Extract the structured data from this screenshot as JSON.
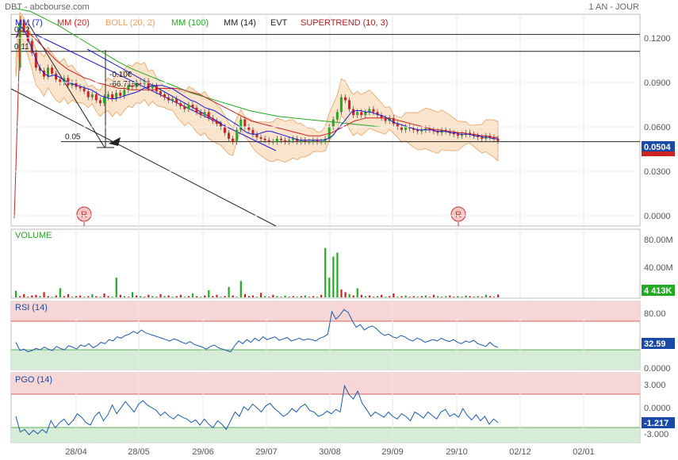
{
  "header": {
    "title": "DBT - abcbourse.com",
    "period": "1 AN - JOUR"
  },
  "legend": [
    {
      "label": "MM (7)",
      "color": "#1a1ad6"
    },
    {
      "label": "MM (20)",
      "color": "#cc2222"
    },
    {
      "label": "BOLL (20, 2)",
      "color": "#e8a060"
    },
    {
      "label": "MM (100)",
      "color": "#22aa22"
    },
    {
      "label": "MM (14)",
      "color": "#222222"
    },
    {
      "label": "EVT",
      "color": "#222222"
    },
    {
      "label": "SUPERTREND (10, 3)",
      "color": "#aa2222"
    }
  ],
  "price_panel": {
    "y_ticks": [
      "0.1200",
      "0.0900",
      "0.0600",
      "0.0300",
      "0.0000"
    ],
    "last_price": "0.0504",
    "h_line_labels": [
      "0.12",
      "0.11",
      "0.05"
    ],
    "annotation": [
      "-0.10€",
      "-66.71%"
    ],
    "markers": [
      "R",
      "R"
    ]
  },
  "volume_panel": {
    "title": "VOLUME",
    "y_ticks": [
      "80.00M",
      "40.00M"
    ],
    "last_value": "4 413K"
  },
  "rsi_panel": {
    "title": "RSI (14)",
    "y_ticks": [
      "80.00",
      "0.0000"
    ],
    "last_value": "32.59"
  },
  "pgo_panel": {
    "title": "PGO (14)",
    "y_ticks": [
      "3.000",
      "0.0000",
      "-3.000"
    ],
    "last_value": "-1.217"
  },
  "x_axis": {
    "labels": [
      "28/04",
      "28/05",
      "29/06",
      "29/07",
      "30/08",
      "29/09",
      "29/10",
      "02/12",
      "02/01"
    ]
  },
  "chart_data": {
    "type": "line",
    "x_range": [
      "2023-04-14",
      "2024-01-15"
    ],
    "price": {
      "ylim": [
        0.0,
        0.135
      ],
      "close": [
        0.1,
        0.13,
        0.125,
        0.118,
        0.11,
        0.1,
        0.098,
        0.094,
        0.1,
        0.096,
        0.092,
        0.09,
        0.093,
        0.088,
        0.09,
        0.087,
        0.086,
        0.084,
        0.08,
        0.082,
        0.078,
        0.076,
        0.08,
        0.082,
        0.079,
        0.083,
        0.081,
        0.085,
        0.088,
        0.087,
        0.09,
        0.089,
        0.091,
        0.086,
        0.088,
        0.084,
        0.082,
        0.08,
        0.078,
        0.079,
        0.076,
        0.074,
        0.072,
        0.075,
        0.073,
        0.07,
        0.068,
        0.07,
        0.066,
        0.064,
        0.062,
        0.06,
        0.056,
        0.052,
        0.05,
        0.058,
        0.065,
        0.06,
        0.058,
        0.055,
        0.053,
        0.052,
        0.051,
        0.05,
        0.05,
        0.052,
        0.051,
        0.05,
        0.051,
        0.052,
        0.05,
        0.051,
        0.05,
        0.05,
        0.051,
        0.05,
        0.05,
        0.052,
        0.06,
        0.065,
        0.07,
        0.08,
        0.078,
        0.072,
        0.068,
        0.07,
        0.068,
        0.07,
        0.072,
        0.07,
        0.068,
        0.066,
        0.064,
        0.066,
        0.062,
        0.06,
        0.058,
        0.06,
        0.059,
        0.058,
        0.057,
        0.058,
        0.059,
        0.058,
        0.057,
        0.056,
        0.058,
        0.057,
        0.056,
        0.055,
        0.054,
        0.055,
        0.056,
        0.055,
        0.054,
        0.053,
        0.052,
        0.054,
        0.053,
        0.052,
        0.0504
      ],
      "mm7": [
        0.12,
        0.128,
        0.124,
        0.116,
        0.108,
        0.1,
        0.096,
        0.094,
        0.095,
        0.094,
        0.092,
        0.09,
        0.089,
        0.088,
        0.087,
        0.086,
        0.085,
        0.083,
        0.081,
        0.08,
        0.079,
        0.079,
        0.08,
        0.081,
        0.082,
        0.083,
        0.084,
        0.086,
        0.087,
        0.088,
        0.088,
        0.088,
        0.087,
        0.086,
        0.084,
        0.082,
        0.08,
        0.078,
        0.077,
        0.075,
        0.073,
        0.072,
        0.071,
        0.069,
        0.067,
        0.065,
        0.063,
        0.061,
        0.058,
        0.056,
        0.055,
        0.055,
        0.056,
        0.057,
        0.057,
        0.056,
        0.055,
        0.054,
        0.053,
        0.052,
        0.051,
        0.051,
        0.051,
        0.051,
        0.051,
        0.051,
        0.052,
        0.054,
        0.058,
        0.062,
        0.066,
        0.07,
        0.071,
        0.071,
        0.07,
        0.07,
        0.069,
        0.068,
        0.067,
        0.065,
        0.063,
        0.062,
        0.061,
        0.06,
        0.059,
        0.058,
        0.058,
        0.058,
        0.058,
        0.057,
        0.057,
        0.057,
        0.056,
        0.056,
        0.055,
        0.055,
        0.055,
        0.054,
        0.054,
        0.053,
        0.053,
        0.052,
        0.052
      ],
      "mm20": [
        0.12,
        0.125,
        0.124,
        0.121,
        0.117,
        0.113,
        0.109,
        0.105,
        0.102,
        0.099,
        0.097,
        0.095,
        0.093,
        0.092,
        0.09,
        0.089,
        0.088,
        0.087,
        0.086,
        0.086,
        0.085,
        0.085,
        0.085,
        0.085,
        0.085,
        0.086,
        0.086,
        0.086,
        0.086,
        0.085,
        0.084,
        0.083,
        0.082,
        0.08,
        0.078,
        0.076,
        0.074,
        0.072,
        0.07,
        0.068,
        0.066,
        0.064,
        0.063,
        0.062,
        0.061,
        0.06,
        0.059,
        0.058,
        0.057,
        0.056,
        0.055,
        0.054,
        0.054,
        0.054,
        0.055,
        0.056,
        0.058,
        0.06,
        0.062,
        0.064,
        0.065,
        0.066,
        0.066,
        0.066,
        0.066,
        0.066,
        0.065,
        0.064,
        0.063,
        0.062,
        0.061,
        0.06,
        0.059,
        0.058,
        0.058,
        0.057,
        0.057,
        0.056,
        0.056,
        0.055,
        0.055,
        0.054,
        0.054,
        0.053,
        0.053
      ],
      "mm100": [
        0.14,
        0.138,
        0.133,
        0.128,
        0.122,
        0.116,
        0.11,
        0.104,
        0.099,
        0.095,
        0.091,
        0.087,
        0.083,
        0.08,
        0.077,
        0.074,
        0.071,
        0.069,
        0.067,
        0.066,
        0.065,
        0.064,
        0.063,
        0.062,
        0.061,
        0.06,
        0.06,
        0.06,
        0.06,
        0.06,
        0.06,
        0.06,
        0.06,
        0.06
      ],
      "h_lines": [
        0.1225,
        0.111,
        0.05
      ]
    },
    "volume": {
      "ylim": [
        0,
        100
      ],
      "unit": "M",
      "values": [
        10,
        2,
        5,
        1,
        3,
        4,
        2,
        8,
        2,
        1,
        3,
        14,
        2,
        5,
        1,
        2,
        3,
        1,
        2,
        5,
        2,
        1,
        6,
        2,
        1,
        30,
        4,
        2,
        1,
        8,
        3,
        2,
        1,
        4,
        2,
        1,
        5,
        2,
        3,
        1,
        2,
        4,
        1,
        2,
        6,
        2,
        1,
        3,
        11,
        2,
        4,
        1,
        2,
        16,
        3,
        1,
        25,
        5,
        2,
        3,
        1,
        7,
        2,
        1,
        4,
        2,
        1,
        3,
        1,
        2,
        1,
        2,
        3,
        1,
        2,
        1,
        4,
        75,
        30,
        62,
        68,
        12,
        8,
        5,
        3,
        14,
        4,
        2,
        3,
        1,
        2,
        4,
        1,
        2,
        6,
        1,
        2,
        3,
        1,
        2,
        1,
        2,
        3,
        1,
        4,
        2,
        1,
        2,
        3,
        1,
        2,
        1,
        3,
        2,
        1,
        2,
        1,
        4,
        2,
        1,
        4.4
      ],
      "up": [
        true,
        false,
        false,
        false,
        false,
        false,
        true,
        false,
        false,
        true,
        false,
        true,
        false,
        false,
        true,
        false,
        false,
        true,
        false,
        true,
        false,
        true,
        false,
        false,
        true,
        true,
        false,
        true,
        false,
        true,
        false,
        true,
        false,
        false,
        true,
        false,
        false,
        true,
        false,
        true,
        false,
        false,
        true,
        false,
        true,
        false,
        true,
        false,
        true,
        false,
        false,
        true,
        false,
        true,
        false,
        true,
        true,
        false,
        false,
        false,
        true,
        false,
        true,
        false,
        false,
        true,
        false,
        true,
        false,
        false,
        true,
        false,
        true,
        false,
        false,
        true,
        false,
        true,
        true,
        true,
        true,
        false,
        false,
        true,
        false,
        true,
        false,
        true,
        false,
        false,
        true,
        false,
        true,
        false,
        false,
        true,
        false,
        true,
        false,
        false,
        true,
        false,
        true,
        false,
        false,
        true,
        false,
        true,
        false,
        false,
        true,
        false,
        true,
        false,
        false,
        true,
        false,
        true,
        false,
        false,
        false
      ]
    },
    "rsi": {
      "ylim": [
        0,
        100
      ],
      "bands": [
        30,
        80
      ],
      "values": [
        40,
        28,
        30,
        26,
        28,
        31,
        29,
        33,
        30,
        28,
        34,
        31,
        29,
        35,
        33,
        30,
        36,
        34,
        38,
        32,
        35,
        40,
        38,
        44,
        42,
        48,
        46,
        50,
        52,
        56,
        53,
        58,
        54,
        52,
        50,
        48,
        46,
        44,
        42,
        45,
        43,
        40,
        38,
        41,
        37,
        35,
        33,
        30,
        34,
        36,
        32,
        30,
        28,
        26,
        35,
        42,
        38,
        44,
        40,
        46,
        42,
        48,
        44,
        46,
        48,
        43,
        45,
        47,
        42,
        44,
        46,
        43,
        45,
        44,
        42,
        46,
        48,
        52,
        85,
        74,
        80,
        88,
        84,
        72,
        62,
        66,
        58,
        62,
        64,
        60,
        54,
        50,
        52,
        48,
        46,
        50,
        48,
        44,
        42,
        46,
        44,
        40,
        42,
        44,
        42,
        46,
        43,
        41,
        44,
        40,
        38,
        42,
        40,
        43,
        38,
        36,
        34,
        40,
        35,
        32.59
      ]
    },
    "pgo": {
      "ylim": [
        -3.5,
        4.5
      ],
      "bands": [
        -2.5,
        2.0
      ],
      "values": [
        -0.5,
        -2.3,
        -2.0,
        -2.6,
        -2.1,
        -2.5,
        -2.0,
        -2.4,
        -1.0,
        -1.8,
        -1.2,
        -0.8,
        -1.5,
        -1.0,
        -0.2,
        -0.6,
        -1.2,
        -1.5,
        -0.5,
        0.0,
        -1.0,
        -0.3,
        0.8,
        -0.2,
        0.5,
        1.2,
        0.6,
        0.0,
        0.9,
        1.3,
        0.8,
        0.5,
        0.2,
        -0.4,
        0.0,
        -0.5,
        -0.8,
        -0.3,
        -0.6,
        -0.8,
        -1.2,
        -0.9,
        -1.5,
        -0.8,
        -1.4,
        -1.8,
        -1.0,
        -1.4,
        -2.0,
        -1.0,
        0.0,
        -0.5,
        0.6,
        0.2,
        0.9,
        0.5,
        0.0,
        0.7,
        1.0,
        0.4,
        0.0,
        -0.5,
        -0.2,
        0.4,
        0.0,
        0.6,
        0.9,
        0.2,
        0.0,
        -0.5,
        -0.3,
        0.1,
        -0.2,
        0.3,
        0.0,
        3.0,
        2.0,
        1.5,
        2.4,
        1.0,
        0.3,
        -0.5,
        0.0,
        -0.3,
        -0.6,
        0.0,
        -0.5,
        -0.8,
        -0.2,
        -0.5,
        -1.0,
        0.0,
        -0.3,
        -0.7,
        0.0,
        -0.4,
        -0.8,
        0.0,
        0.3,
        -0.5,
        -0.2,
        -0.6,
        0.4,
        -0.4,
        -0.9,
        -0.3,
        -1.0,
        -0.5,
        -1.4,
        -0.8,
        -1.217
      ]
    }
  }
}
